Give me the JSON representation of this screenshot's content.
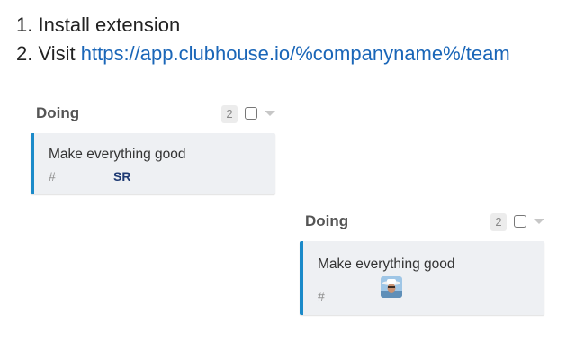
{
  "instructions": {
    "step1": "1. Install extension",
    "step2_prefix": "2. Visit ",
    "step2_link": "https://app.clubhouse.io/%companyname%/team"
  },
  "columns": [
    {
      "title": "Doing",
      "count": "2",
      "card": {
        "title": "Make everything good",
        "id_symbol": "#",
        "owner_initials": "SR",
        "accent_color": "#1b8ac9"
      }
    },
    {
      "title": "Doing",
      "count": "2",
      "card": {
        "title": "Make everything good",
        "id_symbol": "#",
        "owner_avatar": "avatar-photo-icon",
        "accent_color": "#1b8ac9"
      }
    }
  ],
  "colors": {
    "link": "#1a66b8",
    "card_background": "#eef0f3",
    "owner_text": "#1e3a73"
  }
}
